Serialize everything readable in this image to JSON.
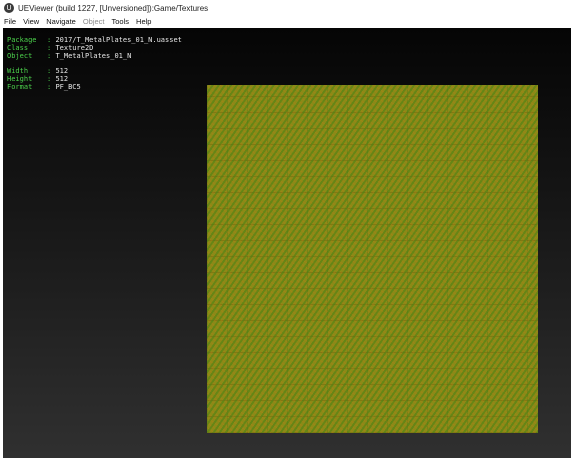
{
  "window": {
    "title": "UEViewer (build 1227, [Unversioned]):Game/Textures",
    "app_icon": "unreal-engine-logo-icon"
  },
  "menu": [
    "File",
    "View",
    "Navigate",
    "Object",
    "Tools",
    "Help"
  ],
  "menu_disabled": [
    "Object"
  ],
  "info": {
    "package_label": "Package",
    "package_value": "2017/T_MetalPlates_01_N.uasset",
    "class_label": "Class",
    "class_value": "Texture2D",
    "object_label": "Object",
    "object_value": "T_MetalPlates_01_N",
    "width_label": "Width",
    "width_value": "512",
    "height_label": "Height",
    "height_value": "512",
    "format_label": "Format",
    "format_value": "PF_BC5"
  },
  "colors": {
    "info_label": "#4cd24c",
    "info_value": "#e8e8e8",
    "texture_base": "#8b8a17",
    "texture_green": "#46821a",
    "texture_orange": "#be7814"
  }
}
